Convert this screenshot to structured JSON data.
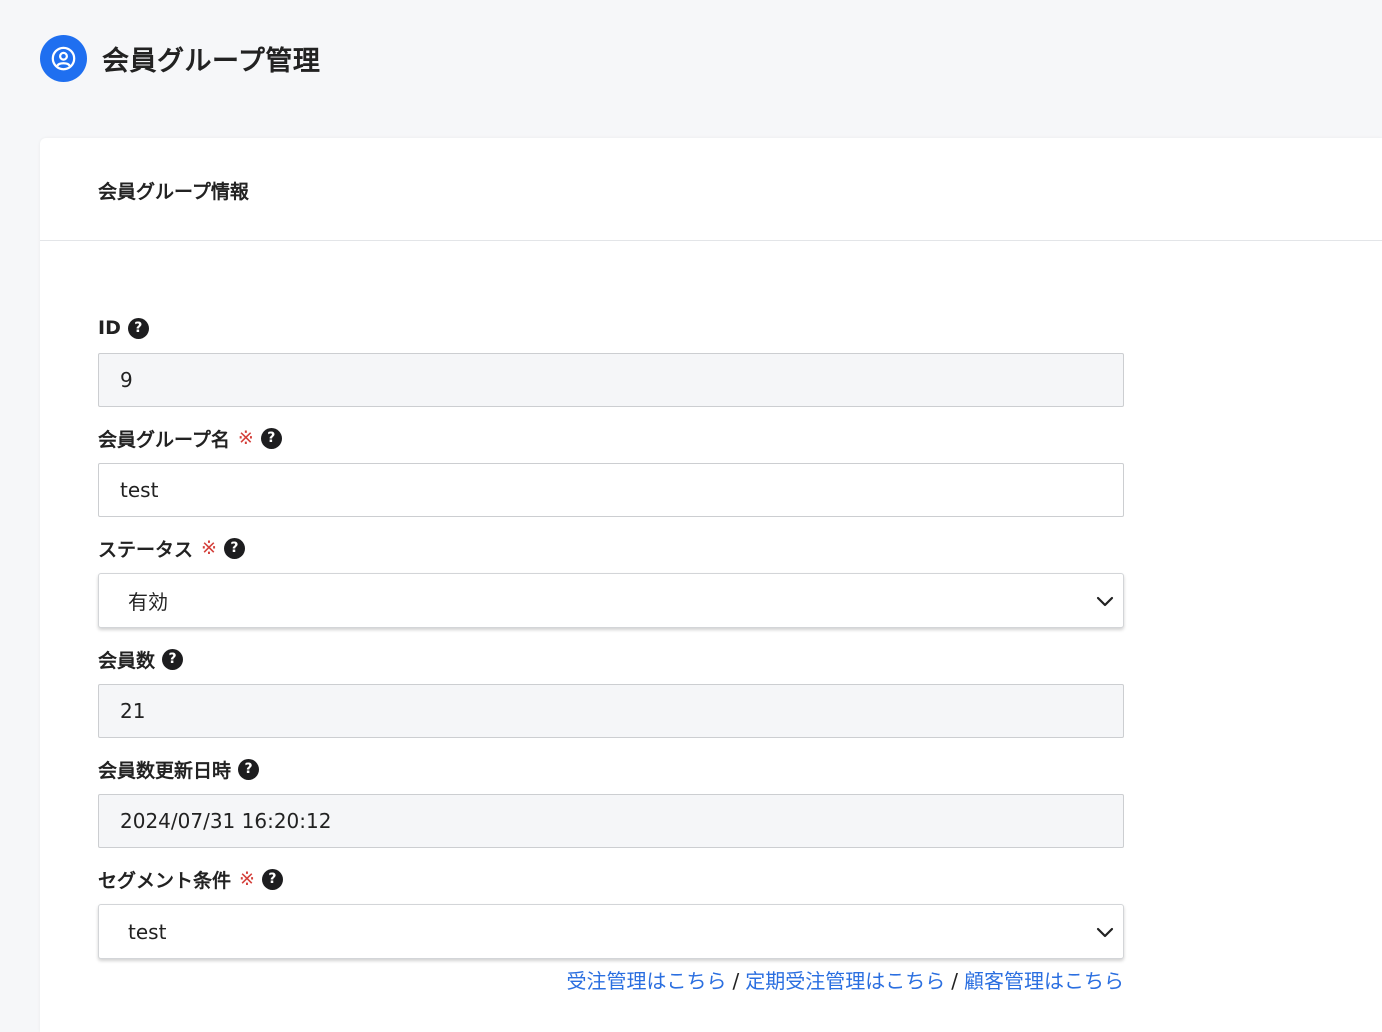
{
  "header": {
    "title": "会員グループ管理",
    "icon": "user-circle-icon",
    "icon_color": "#1f6ff0"
  },
  "card": {
    "title": "会員グループ情報"
  },
  "form": {
    "required_mark": "※",
    "id": {
      "label": "ID",
      "value": "9"
    },
    "name": {
      "label": "会員グループ名",
      "value": "test"
    },
    "status": {
      "label": "ステータス",
      "value": "有効"
    },
    "member_count": {
      "label": "会員数",
      "value": "21"
    },
    "member_count_updated": {
      "label": "会員数更新日時",
      "value": "2024/07/31 16:20:12"
    },
    "segment": {
      "label": "セグメント条件",
      "value": "test"
    }
  },
  "links": {
    "orders": "受注管理はこちら",
    "subscription_orders": "定期受注管理はこちら",
    "customers": "顧客管理はこちら",
    "separator": "/",
    "link_color": "#2b6fe0"
  }
}
